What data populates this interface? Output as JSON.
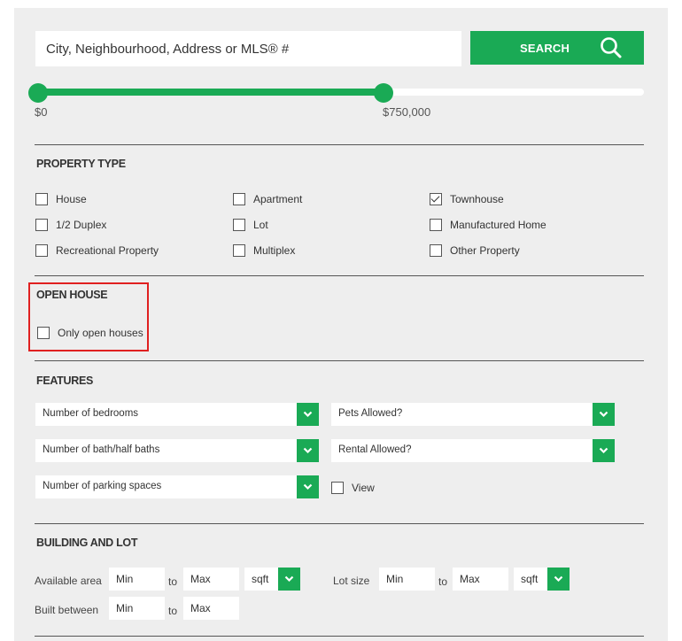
{
  "search": {
    "placeholder": "City, Neighbourhood, Address or MLS® #",
    "button_label": "SEARCH"
  },
  "price_range": {
    "min_label": "$0",
    "max_label": "$750,000",
    "max_fraction": 0.57
  },
  "property_type": {
    "title": "PROPERTY TYPE",
    "options": [
      {
        "label": "House",
        "checked": false
      },
      {
        "label": "Apartment",
        "checked": false
      },
      {
        "label": "Townhouse",
        "checked": true
      },
      {
        "label": "1/2 Duplex",
        "checked": false
      },
      {
        "label": "Lot",
        "checked": false
      },
      {
        "label": "Manufactured Home",
        "checked": false
      },
      {
        "label": "Recreational Property",
        "checked": false
      },
      {
        "label": "Multiplex",
        "checked": false
      },
      {
        "label": "Other Property",
        "checked": false
      }
    ]
  },
  "open_house": {
    "title": "OPEN HOUSE",
    "option_label": "Only open houses",
    "checked": false
  },
  "features": {
    "title": "FEATURES",
    "bedrooms": "Number of bedrooms",
    "pets": "Pets Allowed?",
    "baths": "Number of bath/half baths",
    "rental": "Rental Allowed?",
    "parking": "Number of parking spaces",
    "view_label": "View",
    "view_checked": false
  },
  "building": {
    "title": "BUILDING AND LOT",
    "available_area_label": "Available area",
    "lot_size_label": "Lot size",
    "built_between_label": "Built between",
    "min_placeholder": "Min",
    "max_placeholder": "Max",
    "to_label": "to",
    "unit_label": "sqft"
  },
  "colors": {
    "accent": "#1aaa55",
    "panel": "#eeeeee",
    "highlight": "#e02020"
  }
}
